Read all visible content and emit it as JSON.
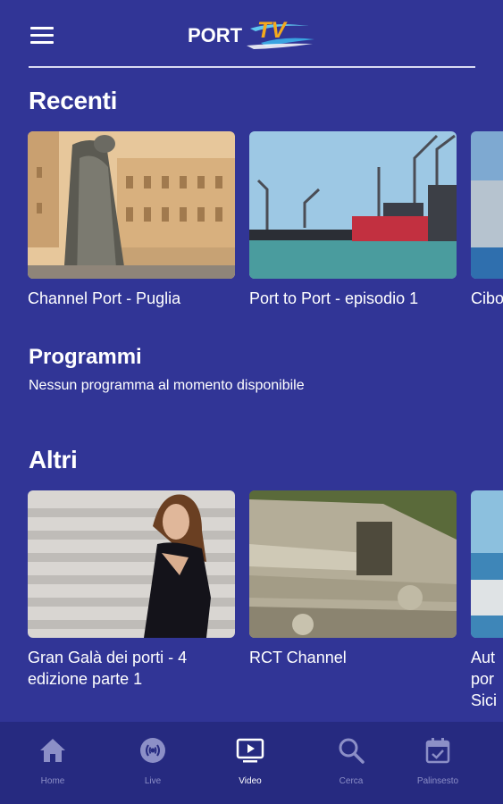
{
  "header": {
    "menu_icon": "hamburger-menu-icon",
    "logo_text_port": "PORT",
    "logo_text_tv": "TV"
  },
  "recenti": {
    "title": "Recenti",
    "items": [
      {
        "label": "Channel Port - Puglia"
      },
      {
        "label": "Port to Port - episodio 1"
      },
      {
        "label": "Cibo"
      }
    ]
  },
  "programmi": {
    "title": "Programmi",
    "empty_text": "Nessun programma al momento disponibile"
  },
  "altri": {
    "title": "Altri",
    "items": [
      {
        "label": "Gran Galà dei porti - 4 edizione parte 1"
      },
      {
        "label": "RCT Channel"
      },
      {
        "label": "Aut\npor\nSici"
      }
    ]
  },
  "bottom_nav": {
    "active": "Video",
    "items": [
      {
        "label": "Home",
        "icon": "home-icon"
      },
      {
        "label": "Live",
        "icon": "live-broadcast-icon"
      },
      {
        "label": "Video",
        "icon": "video-play-icon"
      },
      {
        "label": "Cerca",
        "icon": "search-icon"
      },
      {
        "label": "Palinsesto",
        "icon": "calendar-check-icon"
      }
    ]
  },
  "colors": {
    "background": "#313596",
    "bottom_nav": "#262a80",
    "inactive_nav": "#8c8fc7",
    "text": "#ffffff"
  }
}
